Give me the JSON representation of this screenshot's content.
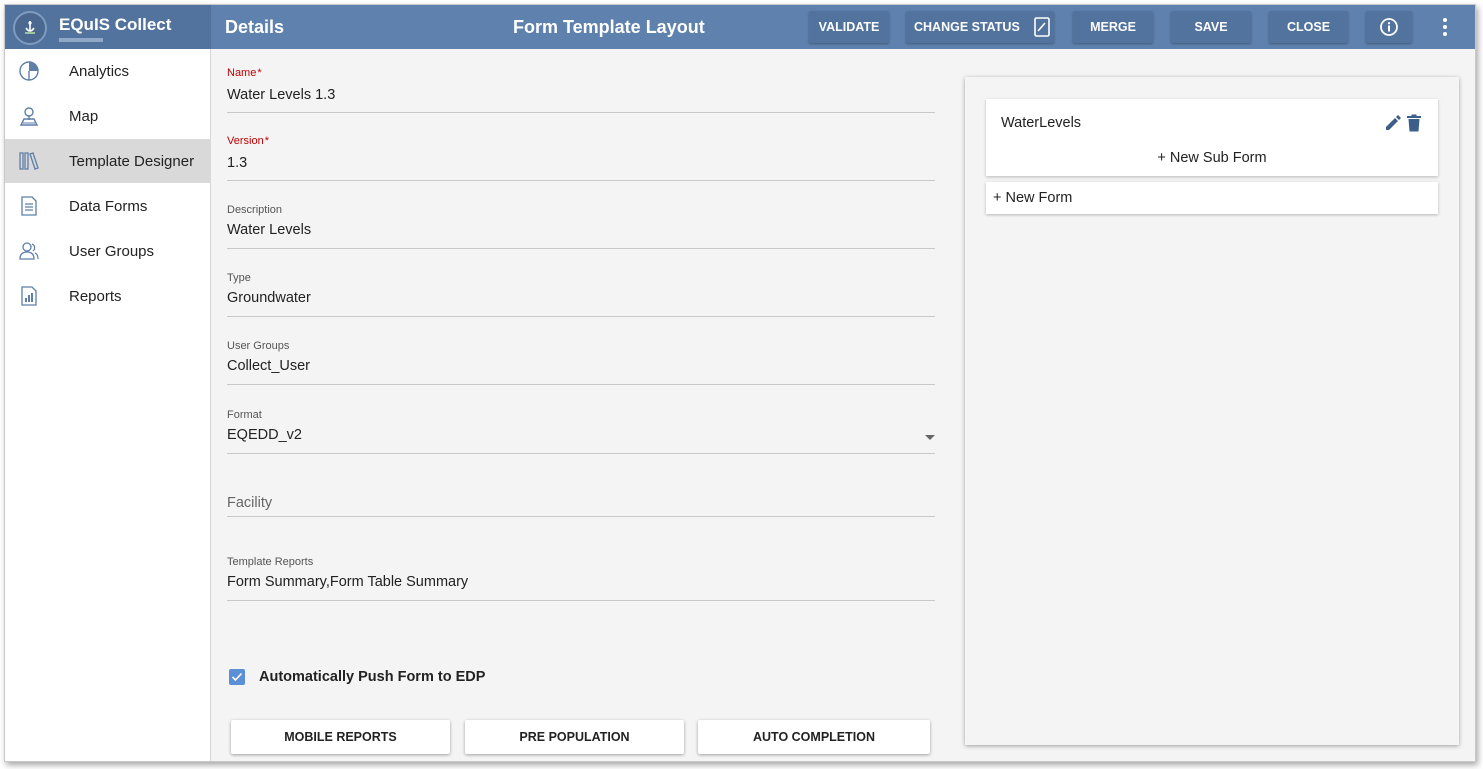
{
  "app": {
    "title": "EQuIS Collect"
  },
  "header": {
    "section_title": "Details",
    "page_title": "Form Template Layout",
    "buttons": {
      "validate": "VALIDATE",
      "change_status": "CHANGE STATUS",
      "merge": "MERGE",
      "save": "SAVE",
      "close": "CLOSE"
    },
    "icons": [
      "change-status-icon",
      "info-icon",
      "more-vert-icon"
    ],
    "colors": {
      "bar": "#5e81ad",
      "button": "#52739d"
    }
  },
  "sidebar": {
    "items": [
      {
        "label": "Analytics",
        "icon": "analytics-icon",
        "active": false
      },
      {
        "label": "Map",
        "icon": "map-icon",
        "active": false
      },
      {
        "label": "Template Designer",
        "icon": "template-designer-icon",
        "active": true
      },
      {
        "label": "Data Forms",
        "icon": "data-forms-icon",
        "active": false
      },
      {
        "label": "User Groups",
        "icon": "user-groups-icon",
        "active": false
      },
      {
        "label": "Reports",
        "icon": "reports-icon",
        "active": false
      }
    ]
  },
  "form": {
    "name": {
      "label": "Name",
      "value": "Water Levels 1.3",
      "required": true
    },
    "version": {
      "label": "Version",
      "value": "1.3",
      "required": true
    },
    "description": {
      "label": "Description",
      "value": "Water Levels"
    },
    "type": {
      "label": "Type",
      "value": "Groundwater"
    },
    "user_groups": {
      "label": "User Groups",
      "value": "Collect_User"
    },
    "format": {
      "label": "Format",
      "value": "EQEDD_v2"
    },
    "facility": {
      "placeholder": "Facility"
    },
    "template_reports": {
      "label": "Template Reports",
      "value": "Form Summary,Form Table Summary"
    },
    "auto_push": {
      "label": "Automatically Push Form to EDP",
      "checked": true
    },
    "buttons": {
      "mobile_reports": "MOBILE REPORTS",
      "pre_population": "PRE POPULATION",
      "auto_completion": "AUTO COMPLETION"
    }
  },
  "layout_panel": {
    "forms": [
      {
        "name": "WaterLevels",
        "new_sub_form": "+ New Sub Form"
      }
    ],
    "new_form": "+ New Form"
  }
}
